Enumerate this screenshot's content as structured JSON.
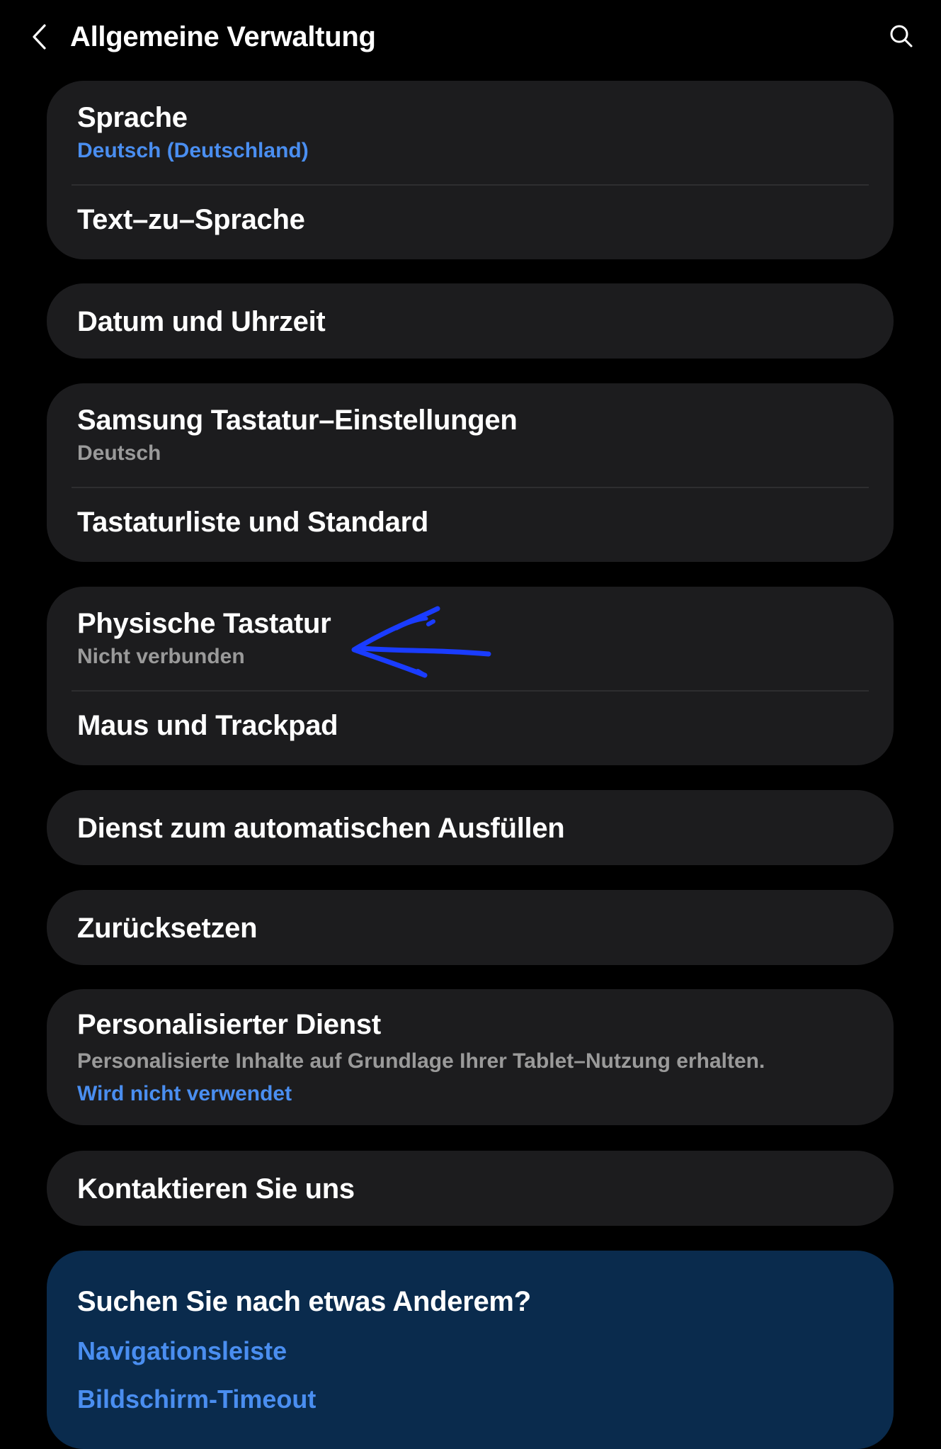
{
  "header": {
    "title": "Allgemeine Verwaltung",
    "back_icon": "chevron-left-icon",
    "search_icon": "search-icon"
  },
  "colors": {
    "background": "#000000",
    "card": "#1c1c1e",
    "suggest_card": "#0a2b4d",
    "accent_blue": "#4a8ef0",
    "subtitle_gray": "#9a9a9a",
    "annotation_blue": "#1a3cff"
  },
  "cards": {
    "language": {
      "sprache": {
        "title": "Sprache",
        "subtitle": "Deutsch (Deutschland)"
      },
      "tts": {
        "title": "Text–zu–Sprache"
      }
    },
    "datetime": {
      "title": "Datum und Uhrzeit"
    },
    "keyboard": {
      "samsung": {
        "title": "Samsung Tastatur–Einstellungen",
        "subtitle": "Deutsch"
      },
      "list": {
        "title": "Tastaturliste und Standard"
      }
    },
    "physical": {
      "keyboard": {
        "title": "Physische Tastatur",
        "subtitle": "Nicht verbunden"
      },
      "mouse": {
        "title": "Maus und Trackpad"
      }
    },
    "autofill": {
      "title": "Dienst zum automatischen Ausfüllen"
    },
    "reset": {
      "title": "Zurücksetzen"
    },
    "personalized": {
      "title": "Personalisierter Dienst",
      "description": "Personalisierte Inhalte auf Grundlage Ihrer Tablet–Nutzung erhalten.",
      "status": "Wird nicht verwendet"
    },
    "contact": {
      "title": "Kontaktieren Sie uns"
    }
  },
  "suggestions": {
    "heading": "Suchen Sie nach etwas Anderem?",
    "links": [
      "Navigationsleiste",
      "Bildschirm-Timeout"
    ]
  }
}
